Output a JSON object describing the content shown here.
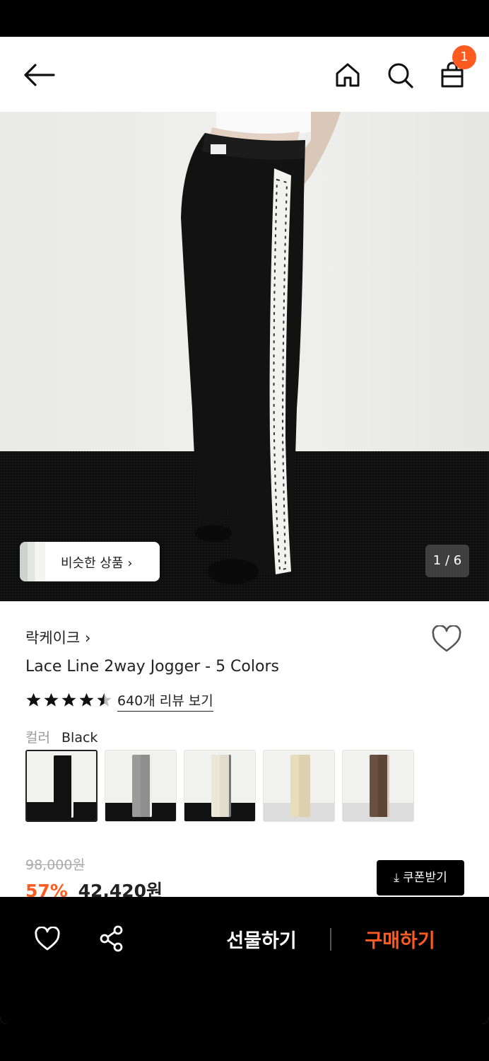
{
  "header": {
    "cart_badge": "1",
    "icons": [
      "back-arrow-icon",
      "home-icon",
      "search-icon",
      "shopping-bag-icon"
    ]
  },
  "gallery": {
    "similar_label": "비슷한 상품 ›",
    "counter": "1 / 6"
  },
  "product": {
    "brand": "락케이크 ›",
    "title": "Lace Line 2way Jogger - 5 Colors",
    "rating": 4.5,
    "review_link": "640개 리뷰 보기",
    "color_label": "컬러",
    "color_value": "Black",
    "swatches": [
      {
        "name": "Black",
        "color": "#111111"
      },
      {
        "name": "Gray",
        "color": "#9a9a9a"
      },
      {
        "name": "Ivory",
        "color": "#ece6d8"
      },
      {
        "name": "Cream",
        "color": "#e8dcbc"
      },
      {
        "name": "Brown",
        "color": "#6a5040"
      }
    ],
    "original_price": "98,000원",
    "discount": "57%",
    "price": "42,420원",
    "coupon_label": "⤓ 쿠폰받기"
  },
  "bottom_bar": {
    "gift_label": "선물하기",
    "buy_label": "구매하기"
  },
  "colors": {
    "accent": "#ff5a1f",
    "text": "#222222"
  }
}
